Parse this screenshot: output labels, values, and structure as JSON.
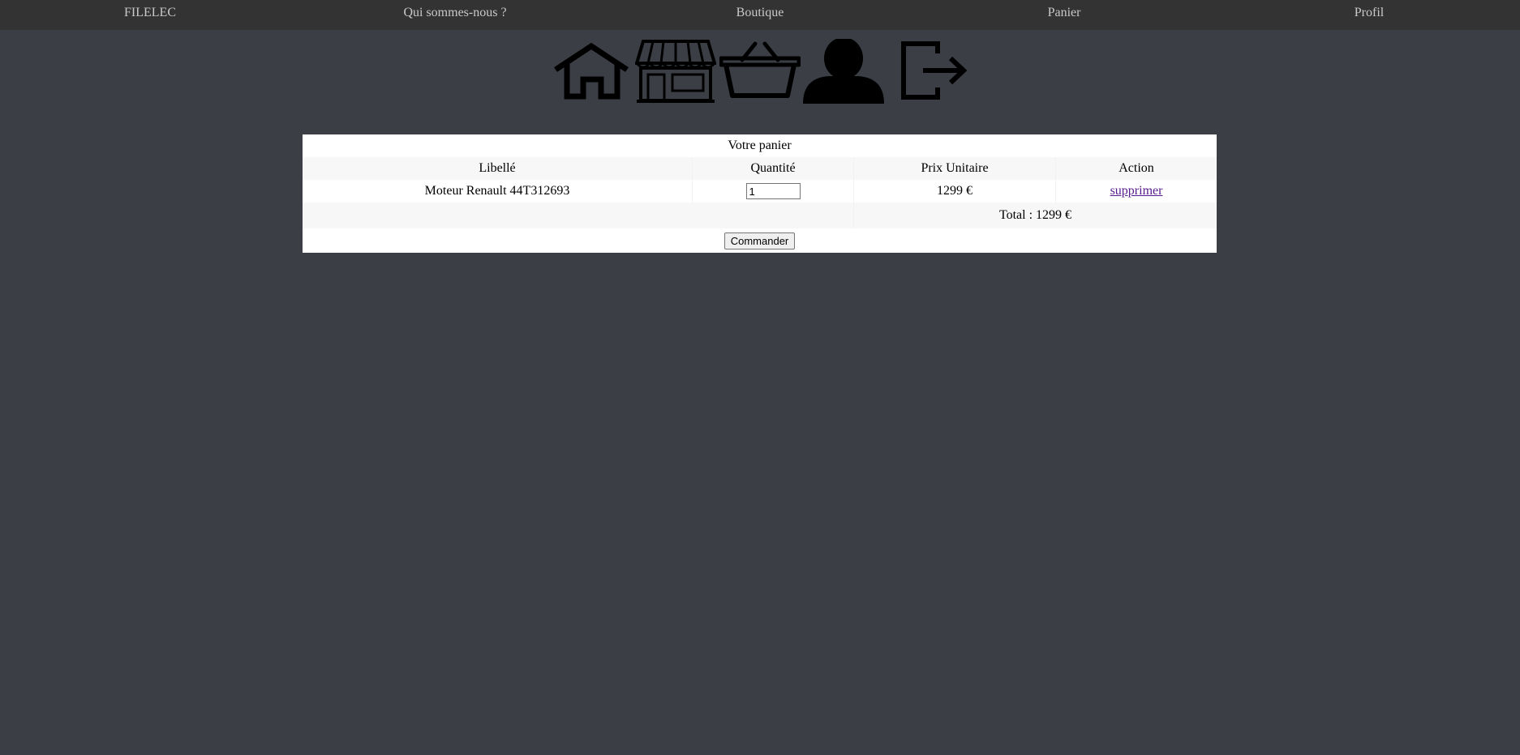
{
  "nav": {
    "brand": "FILELEC",
    "about": "Qui sommes-nous ?",
    "shop": "Boutique",
    "cart": "Panier",
    "profile": "Profil"
  },
  "icons": [
    "home-icon",
    "store-icon",
    "basket-icon",
    "user-icon",
    "logout-icon"
  ],
  "cart": {
    "title": "Votre panier",
    "headers": {
      "label": "Libellé",
      "quantity": "Quantité",
      "unit_price": "Prix Unitaire",
      "action": "Action"
    },
    "items": [
      {
        "label": "Moteur Renault 44T312693",
        "quantity": "1",
        "unit_price": "1299 €",
        "action": "supprimer"
      }
    ],
    "total": "Total : 1299 €",
    "order_button": "Commander"
  },
  "colors": {
    "page_bg": "#3b3e44",
    "topbar_bg": "#333333",
    "nav_text": "#c9c9c9",
    "link_visited": "#551a8b"
  }
}
